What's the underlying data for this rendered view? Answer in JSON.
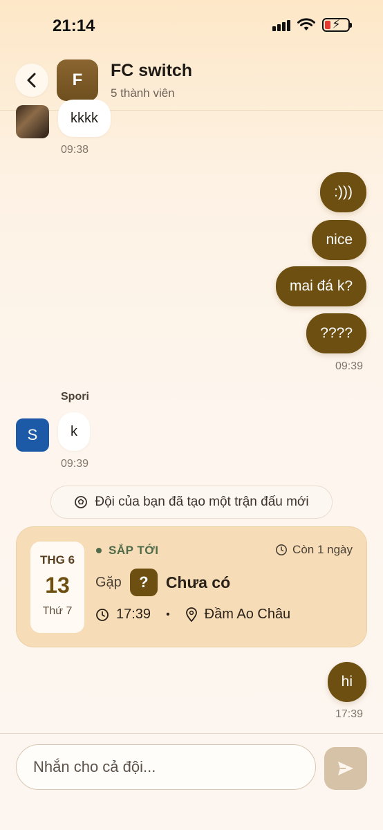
{
  "status_bar": {
    "time": "21:14"
  },
  "header": {
    "avatar_letter": "F",
    "title": "FC switch",
    "subtitle": "5 thành viên"
  },
  "messages": {
    "m1": {
      "text": "kkkk",
      "time": "09:38"
    },
    "m2": {
      "text": ":)))"
    },
    "m3": {
      "text": "nice"
    },
    "m4": {
      "text": "mai đá k?"
    },
    "m5": {
      "text": "????",
      "time": "09:39"
    },
    "m6": {
      "sender": "Spori",
      "avatar_letter": "S",
      "text": "k",
      "time": "09:39"
    },
    "m7": {
      "text": "hi",
      "time": "17:39"
    }
  },
  "system_notice": {
    "text": "Đội của bạn đã tạo một trận đấu mới"
  },
  "match_card": {
    "month": "THG 6",
    "day": "13",
    "weekday": "Thứ 7",
    "status": "SẮP TỚI",
    "countdown": "Còn 1 ngày",
    "vs_label": "Gặp",
    "opponent_icon": "?",
    "opponent": "Chưa có",
    "kickoff": "17:39",
    "separator": "•",
    "venue": "Đầm Ao Châu"
  },
  "composer": {
    "placeholder": "Nhắn cho cả đội..."
  },
  "colors": {
    "accent": "#6e4f12",
    "card_bg": "#f6ddb8",
    "status_green": "#4f6b4a",
    "user_s_avatar": "#1c5aa8"
  }
}
